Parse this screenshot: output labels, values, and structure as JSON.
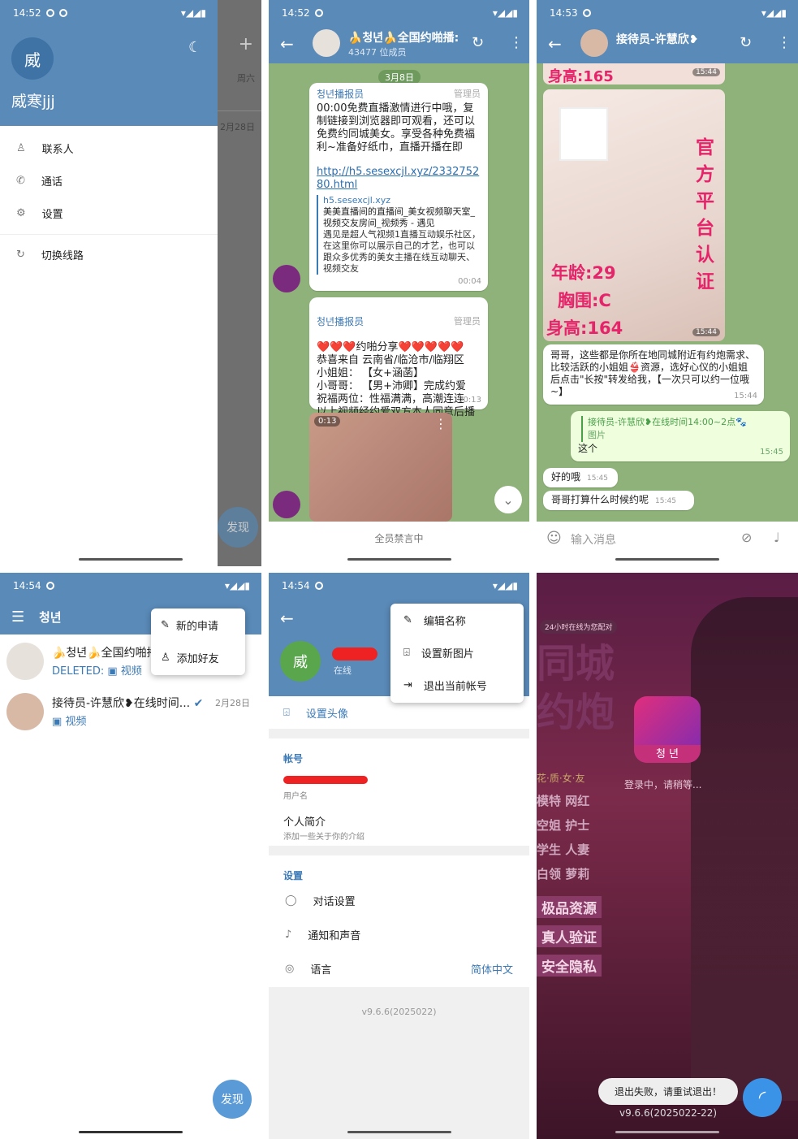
{
  "p1": {
    "time": "14:52",
    "avatar": "威",
    "username": "威寒jjj",
    "menu": [
      "联系人",
      "通话",
      "设置"
    ],
    "switch": "切换线路",
    "bg_days": [
      "周六",
      "2月28日"
    ],
    "fab": "发现"
  },
  "p2": {
    "time": "14:52",
    "title": "🍌청년🍌全国约啪播:",
    "members": "43477 位成员",
    "date": "3月8日",
    "m1": {
      "name": "청년播报员",
      "admin": "管理员",
      "text": "00:00免费直播激情进行中哦，复制链接到浏览器即可观看，还可以免费约同城美女。享受各种免费福利~准备好纸巾，直播开播在即",
      "link": "http://h5.sesexcjl.xyz/233275280.html",
      "site": "h5.sesexcjl.xyz",
      "ptitle": "美美直播间的直播间_美女视频聊天室_视频交友房间_视频秀 - 遇见",
      "pdesc": "遇见是超人气视频1直播互动娱乐社区，在这里你可以展示自己的才艺，也可以跟众多优秀的美女主播在线互动聊天、视频交友",
      "time": "00:04"
    },
    "m2": {
      "name": "청년播报员",
      "admin": "管理员",
      "text": "❤️❤️❤️约啪分享❤️❤️❤️❤️❤️\n恭喜来自  云南省/临沧市/临翔区\n小姐姐：  【女+涵菡】\n小哥哥：  【男+沛卿】完成约爱\n祝福两位：性福满满，高潮连连\n以上视频经约爱双方本人同意后播报分享",
      "time": "00:13"
    },
    "video": "0:13",
    "muted": "全员禁言中"
  },
  "p3": {
    "time": "14:53",
    "title": "接待员-许慧欣❥",
    "img1_text": "身高:165",
    "img1_time": "15:44",
    "overlay_age": "年龄:29",
    "overlay_chest": "胸围:C",
    "overlay_h": "身高:164",
    "side_text": "官方平台认证",
    "img2_time": "15:44",
    "m1": {
      "text": "哥哥，这些都是你所在地同城附近有约炮需求、比较活跃的小姐姐👙资源，选好心仪的小姐姐后点击\"长按\"转发给我，【一次只可以约一位哦~】",
      "time": "15:44"
    },
    "reply": {
      "name": "接待员-许慧欣❥在线时间14:00~2点🐾",
      "sub": "图片",
      "text": "这个",
      "time": "15:45"
    },
    "m2": {
      "text": "好的哦",
      "time": "15:45"
    },
    "m3": {
      "text": "哥哥打算什么时候约呢",
      "time": "15:45"
    },
    "input": "输入消息"
  },
  "p4": {
    "time": "14:54",
    "title": "청년",
    "menu": [
      "新的申请",
      "添加好友"
    ],
    "chats": [
      {
        "name": "🍌청년🍌全国约啪播",
        "sub_prefix": "DELETED:",
        "sub": "视频"
      },
      {
        "name": "接待员-许慧欣❥在线时间...",
        "date": "2月28日",
        "sub": "视频"
      }
    ],
    "fab": "发现"
  },
  "p5": {
    "time": "14:54",
    "avatar": "威",
    "status": "在线",
    "menu": [
      "编辑名称",
      "设置新图片",
      "退出当前帐号"
    ],
    "set_photo": "设置头像",
    "account": "帐号",
    "username_label": "用户名",
    "bio": "个人简介",
    "bio_sub": "添加一些关于你的介绍",
    "settings": "设置",
    "items": [
      "对话设置",
      "通知和声音",
      "语言"
    ],
    "lang_val": "简体中文",
    "version": "v9.6.6(2025022)"
  },
  "p6": {
    "badge": "24小时在线为您配对",
    "title_top": "同城",
    "title_bot": "约炮",
    "app_name": "청 년",
    "loading": "登录中，请稍等...",
    "slogan": "花·质·女·友",
    "tags1": [
      "模特",
      "网红"
    ],
    "tags2": [
      "空姐",
      "护士"
    ],
    "tags3": [
      "学生",
      "人妻"
    ],
    "tags4": [
      "白领",
      "萝莉"
    ],
    "tag_boxes": [
      "极品资源",
      "真人验证",
      "安全隐私"
    ],
    "toast": "退出失败，请重试退出！",
    "version": "v9.6.6(2025022-22)"
  },
  "colors": {
    "header": "#5a8ab8",
    "accent": "#3c7ab6",
    "chatbg": "#8fb27a"
  }
}
